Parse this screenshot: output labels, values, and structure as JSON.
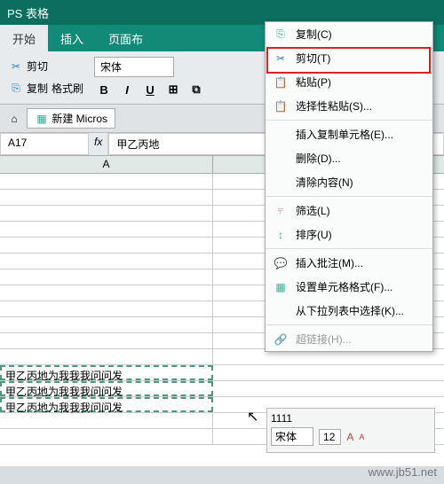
{
  "app": {
    "title": "PS 表格"
  },
  "tabs": {
    "t0": "开始",
    "t1": "插入",
    "t2": "页面布"
  },
  "ribbon": {
    "cut": "剪切",
    "copy": "复制",
    "formatpainter": "格式刷",
    "font": "宋体",
    "newdoc": "新建 Micros"
  },
  "namebox": {
    "ref": "A17",
    "formula": "甲乙丙地"
  },
  "col": {
    "A": "A"
  },
  "cells": {
    "r17": "甲乙丙地为我我我问问发",
    "r18": "甲乙丙地为我我我问问发",
    "r19": "甲乙丙地为我我我问问发"
  },
  "ctx": {
    "copy": "复制(C)",
    "cut": "剪切(T)",
    "paste": "粘贴(P)",
    "pastespecial": "选择性粘贴(S)...",
    "insertcopied": "插入复制单元格(E)...",
    "delete": "删除(D)...",
    "clear": "清除内容(N)",
    "filter": "筛选(L)",
    "sort": "排序(U)",
    "insertcomment": "插入批注(M)...",
    "formatcells": "设置单元格格式(F)...",
    "picklist": "从下拉列表中选择(K)...",
    "hyperlink": "超链接(H)..."
  },
  "mini": {
    "val": "1111",
    "font": "宋体",
    "size": "12"
  },
  "watermark": "www.jb51.net"
}
